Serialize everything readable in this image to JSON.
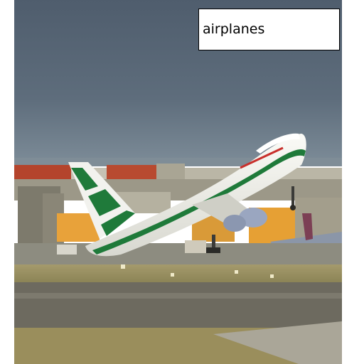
{
  "caption": {
    "text": "airplanes"
  },
  "photo": {
    "subject": "airliner-taking-off",
    "colors": {
      "sky": "#5b6a7a",
      "livery_green": "#1f7a3a",
      "fuselage_white": "#f2f2ee",
      "terminal_orange": "#e8a23a",
      "runway": "#6d6a5f",
      "grass": "#9a8e5c"
    }
  }
}
